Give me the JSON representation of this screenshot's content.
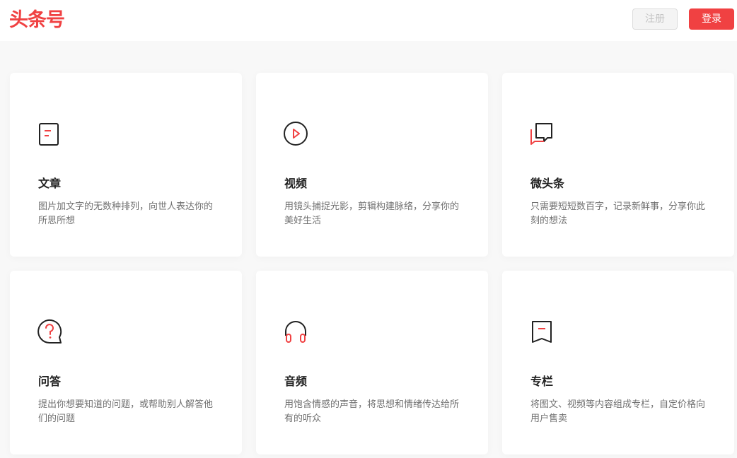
{
  "header": {
    "logo": "头条号",
    "register_label": "注册",
    "login_label": "登录"
  },
  "colors": {
    "accent": "#f04142",
    "icon_stroke": "#222222"
  },
  "cards": [
    {
      "icon": "article-icon",
      "title": "文章",
      "desc": "图片加文字的无数种排列，向世人表达你的所思所想"
    },
    {
      "icon": "play-icon",
      "title": "视频",
      "desc": "用镜头捕捉光影，剪辑构建脉络，分享你的美好生活"
    },
    {
      "icon": "chat-bubbles-icon",
      "title": "微头条",
      "desc": "只需要短短数百字，记录新鲜事，分享你此刻的想法"
    },
    {
      "icon": "question-icon",
      "title": "问答",
      "desc": "提出你想要知道的问题，或帮助别人解答他们的问题"
    },
    {
      "icon": "headphones-icon",
      "title": "音频",
      "desc": "用饱含情感的声音，将思想和情绪传达给所有的听众"
    },
    {
      "icon": "bookmark-icon",
      "title": "专栏",
      "desc": "将图文、视频等内容组成专栏，自定价格向用户售卖"
    }
  ]
}
